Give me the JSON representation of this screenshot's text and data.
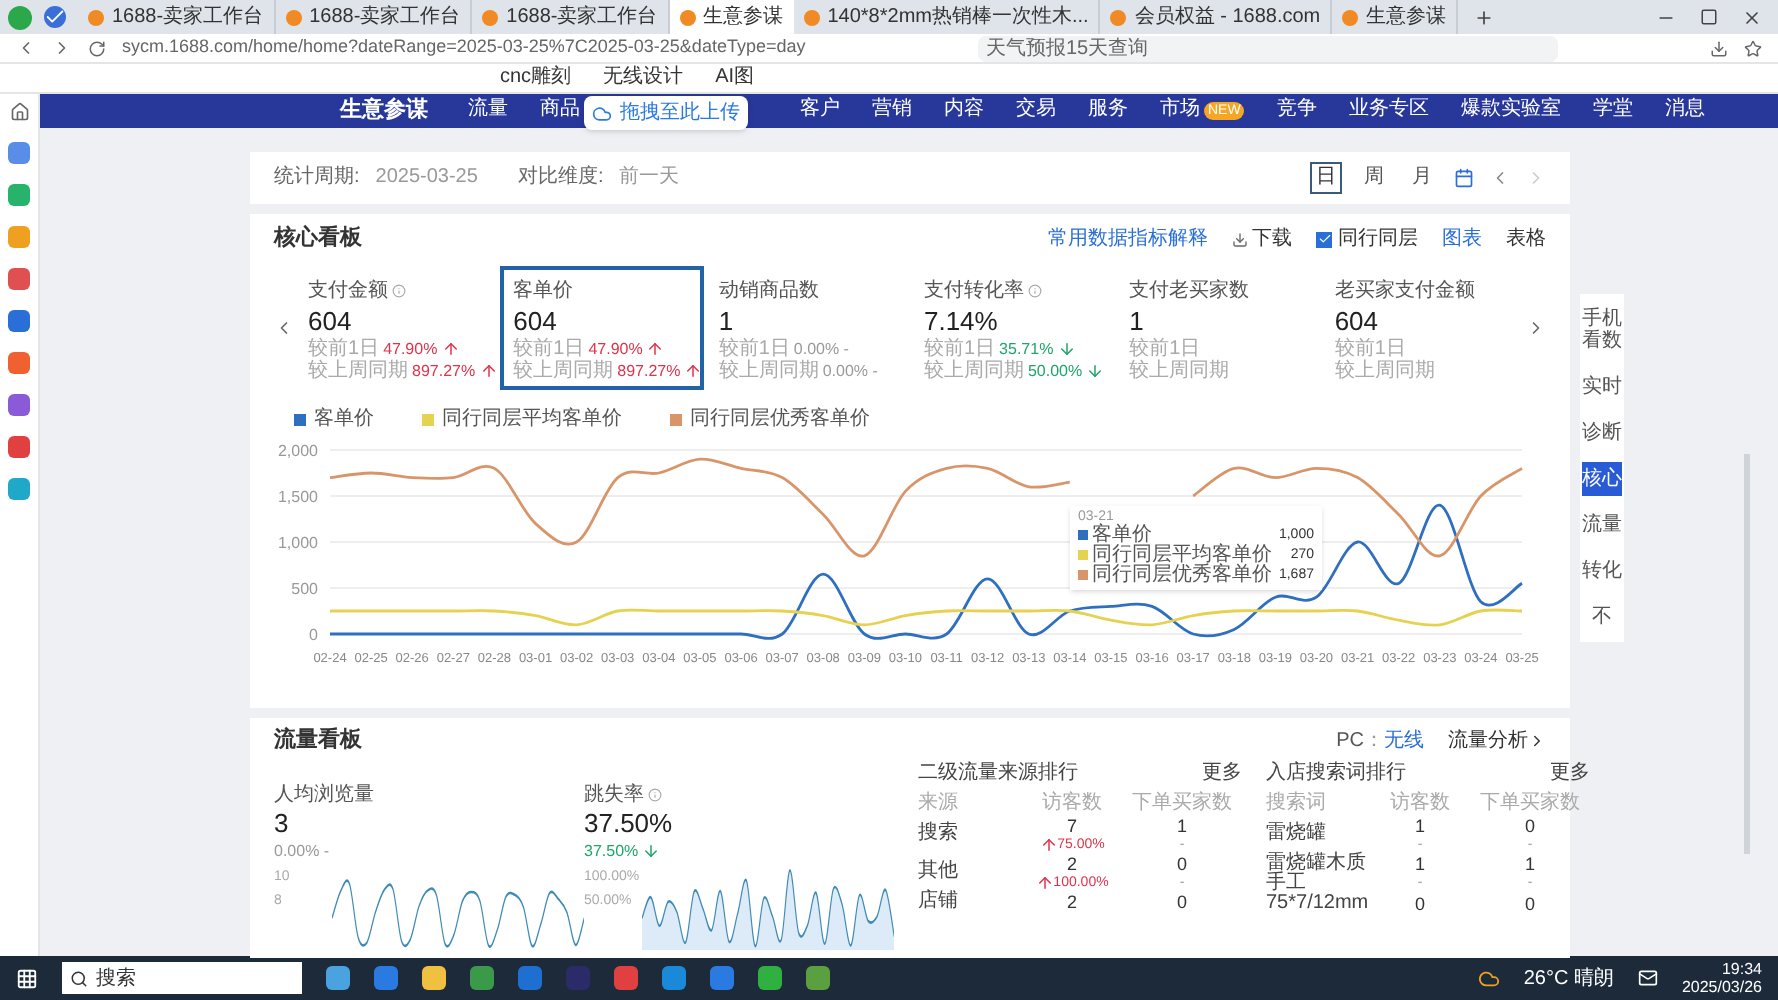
{
  "browser": {
    "tabs": [
      {
        "title": "1688-卖家工作台",
        "selected": false
      },
      {
        "title": "1688-卖家工作台",
        "selected": false
      },
      {
        "title": "1688-卖家工作台",
        "selected": false
      },
      {
        "title": "生意参谋",
        "selected": true
      },
      {
        "title": "140*8*2mm热销棒一次性木...",
        "selected": false
      },
      {
        "title": "会员权益 - 1688.com",
        "selected": false
      },
      {
        "title": "生意参谋",
        "selected": false
      }
    ],
    "url": "sycm.1688.com/home/home?dateRange=2025-03-25%7C2025-03-25&dateType=day",
    "search_placeholder": "天气预报15天查询",
    "bookmarks": [
      "cnc雕刻",
      "无线设计",
      "AI图"
    ]
  },
  "upload_badge": "拖拽至此上传",
  "nav": {
    "logo": "生意参谋",
    "items_before": [
      "流量",
      "商品"
    ],
    "items_after": [
      {
        "label": "客户"
      },
      {
        "label": "营销"
      },
      {
        "label": "内容"
      },
      {
        "label": "交易"
      },
      {
        "label": "服务"
      },
      {
        "label": "市场",
        "badge": "NEW"
      },
      {
        "label": "竞争"
      },
      {
        "label": "业务专区"
      },
      {
        "label": "爆款实验室"
      },
      {
        "label": "学堂"
      },
      {
        "label": "消息"
      }
    ]
  },
  "period": {
    "label": "统计周期:",
    "value": "2025-03-25",
    "compare_label": "对比维度:",
    "compare_value": "前一天",
    "ranges": [
      {
        "label": "日",
        "selected": true
      },
      {
        "label": "周",
        "selected": false
      },
      {
        "label": "月",
        "selected": false
      }
    ]
  },
  "core": {
    "title": "核心看板",
    "explain_link": "常用数据指标解释",
    "download": "下载",
    "peer_toggle": {
      "label": "同行同层",
      "checked": true
    },
    "view_chart": "图表",
    "view_table": "表格",
    "metrics": [
      {
        "name": "支付金额",
        "info": true,
        "value": "604",
        "selected": false,
        "lines": [
          {
            "label": "较前1日",
            "value": "47.90%",
            "kind": "up"
          },
          {
            "label": "较上周同期",
            "value": "897.27%",
            "kind": "up"
          }
        ]
      },
      {
        "name": "客单价",
        "info": false,
        "value": "604",
        "selected": true,
        "lines": [
          {
            "label": "较前1日",
            "value": "47.90%",
            "kind": "up"
          },
          {
            "label": "较上周同期",
            "value": "897.27%",
            "kind": "up"
          }
        ]
      },
      {
        "name": "动销商品数",
        "info": false,
        "value": "1",
        "selected": false,
        "lines": [
          {
            "label": "较前1日",
            "value": "0.00% -",
            "kind": "flat"
          },
          {
            "label": "较上周同期",
            "value": "0.00% -",
            "kind": "flat"
          }
        ]
      },
      {
        "name": "支付转化率",
        "info": true,
        "value": "7.14%",
        "selected": false,
        "lines": [
          {
            "label": "较前1日",
            "value": "35.71%",
            "kind": "down"
          },
          {
            "label": "较上周同期",
            "value": "50.00%",
            "kind": "down"
          }
        ]
      },
      {
        "name": "支付老买家数",
        "info": false,
        "value": "1",
        "selected": false,
        "lines": [
          {
            "label": "较前1日"
          },
          {
            "label": "较上周同期"
          }
        ]
      },
      {
        "name": "老买家支付金额",
        "info": false,
        "value": "604",
        "selected": false,
        "lines": [
          {
            "label": "较前1日"
          },
          {
            "label": "较上周同期"
          }
        ]
      }
    ],
    "chart_data": {
      "type": "line",
      "grid": true,
      "legend": true,
      "categories": [
        "02-24",
        "02-25",
        "02-26",
        "02-27",
        "02-28",
        "03-01",
        "03-02",
        "03-03",
        "03-04",
        "03-05",
        "03-06",
        "03-07",
        "03-08",
        "03-09",
        "03-10",
        "03-11",
        "03-12",
        "03-13",
        "03-14",
        "03-15",
        "03-16",
        "03-17",
        "03-18",
        "03-19",
        "03-20",
        "03-21",
        "03-22",
        "03-23",
        "03-24",
        "03-25"
      ],
      "series": [
        {
          "name": "客单价",
          "color": "#2f6fc0",
          "values": [
            0,
            0,
            0,
            0,
            0,
            0,
            0,
            0,
            0,
            0,
            0,
            0,
            650,
            0,
            0,
            0,
            600,
            0,
            250,
            300,
            300,
            0,
            50,
            400,
            400,
            1000,
            550,
            1400,
            350,
            550
          ]
        },
        {
          "name": "同行同层平均客单价",
          "color": "#e6d250",
          "values": [
            250,
            250,
            250,
            250,
            250,
            200,
            100,
            250,
            250,
            250,
            250,
            250,
            200,
            100,
            200,
            250,
            250,
            250,
            250,
            150,
            100,
            200,
            250,
            250,
            250,
            250,
            150,
            100,
            250,
            250
          ]
        },
        {
          "name": "同行同层优秀客单价",
          "color": "#d9956a",
          "values": [
            1700,
            1750,
            1700,
            1700,
            1800,
            1200,
            1000,
            1700,
            1750,
            1900,
            1800,
            1700,
            1300,
            850,
            1550,
            1800,
            1800,
            1600,
            1650,
            null,
            null,
            1500,
            1800,
            1700,
            1800,
            1700,
            1300,
            850,
            1500,
            1800
          ]
        }
      ],
      "ylim": [
        0,
        2000
      ],
      "yticks": [
        {
          "value": 2000,
          "label": "2,000"
        },
        {
          "value": 1500,
          "label": "1,500"
        },
        {
          "value": 1000,
          "label": "1,000"
        },
        {
          "value": 500,
          "label": "500"
        },
        {
          "value": 0,
          "label": "0"
        }
      ]
    },
    "tooltip": {
      "title": "03-21",
      "rows": [
        {
          "name": "客单价",
          "color": "#2f6fc0",
          "value": "1,000"
        },
        {
          "name": "同行同层平均客单价",
          "color": "#e6d250",
          "value": "270"
        },
        {
          "name": "同行同层优秀客单价",
          "color": "#d9956a",
          "value": "1,687"
        }
      ]
    }
  },
  "traffic": {
    "title": "流量看板",
    "device_options": [
      {
        "label": "PC",
        "selected": false
      },
      {
        "label": "无线",
        "selected": true
      }
    ],
    "device_separator": "：",
    "analysis_link": "流量分析",
    "metrics": [
      {
        "name": "人均浏览量",
        "info": false,
        "value": "3",
        "change": "0.00% -",
        "kind": "flat",
        "axis_labels": [
          "10",
          "8"
        ]
      },
      {
        "name": "跳失率",
        "info": true,
        "value": "37.50%",
        "change": "37.50%",
        "kind": "down",
        "axis_labels": [
          "100.00%",
          "50.00%"
        ]
      }
    ],
    "tables": [
      {
        "title": "二级流量来源排行",
        "more": "更多",
        "columns": [
          "来源",
          "访客数",
          "下单买家数"
        ],
        "rows": [
          {
            "cells": [
              "搜索",
              "7",
              "1"
            ],
            "changes": [
              {
                "value": "75.00%",
                "kind": "up"
              },
              {
                "value": "-",
                "kind": "flat"
              }
            ]
          },
          {
            "cells": [
              "其他",
              "2",
              "0"
            ],
            "changes": [
              {
                "value": "100.00%",
                "kind": "up"
              },
              {
                "value": "-",
                "kind": "flat"
              }
            ]
          },
          {
            "cells": [
              "店铺",
              "2",
              "0"
            ]
          }
        ]
      },
      {
        "title": "入店搜索词排行",
        "more": "更多",
        "columns": [
          "搜索词",
          "访客数",
          "下单买家数"
        ],
        "rows": [
          {
            "cells": [
              "雷烧罐",
              "1",
              "0"
            ],
            "changes": [
              {
                "value": "-",
                "kind": "flat"
              },
              {
                "value": "-",
                "kind": "flat"
              }
            ]
          },
          {
            "cells": [
              "雷烧罐木质手工",
              "1",
              "1"
            ],
            "changes": [
              {
                "value": "-",
                "kind": "flat"
              },
              {
                "value": "-",
                "kind": "flat"
              }
            ]
          },
          {
            "cells": [
              "75*7/12mm",
              "0",
              "0"
            ]
          }
        ]
      }
    ]
  },
  "side_tools": [
    {
      "label": "手机看数",
      "selected": false
    },
    {
      "label": "实时",
      "selected": false
    },
    {
      "label": "诊断",
      "selected": false
    },
    {
      "label": "核心",
      "selected": true
    },
    {
      "label": "流量",
      "selected": false
    },
    {
      "label": "转化",
      "selected": false
    },
    {
      "label": "不",
      "selected": false
    }
  ],
  "taskbar": {
    "search": "搜索",
    "weather": "26°C 晴朗",
    "time": "19:34",
    "date": "2025/03/26"
  }
}
